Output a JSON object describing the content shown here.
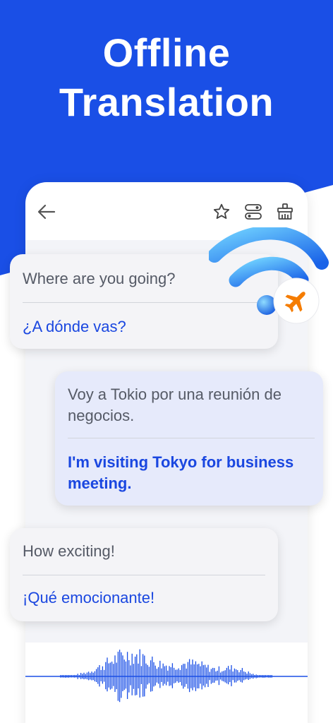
{
  "headline": {
    "line1": "Offline",
    "line2": "Translation"
  },
  "colors": {
    "brand_blue": "#1a4fe6",
    "text_gray": "#555a66",
    "translation_blue": "#1a47e0",
    "accent_orange": "#f57c00"
  },
  "toolbar": {
    "back_icon": "arrow-left-icon",
    "favorite_icon": "star-icon",
    "toggle_icon": "toggle-switch-icon",
    "clear_icon": "broom-icon"
  },
  "messages": [
    {
      "source": "Where are you going?",
      "translation": "¿A dónde vas?"
    },
    {
      "source": "Voy a Tokio por una reunión de negocios.",
      "translation": "I'm visiting Tokyo for business meeting."
    },
    {
      "source": "How exciting!",
      "translation": "¡Qué emocionante!"
    }
  ],
  "badge": {
    "icon": "wifi-icon",
    "overlay_icon": "airplane-icon"
  }
}
